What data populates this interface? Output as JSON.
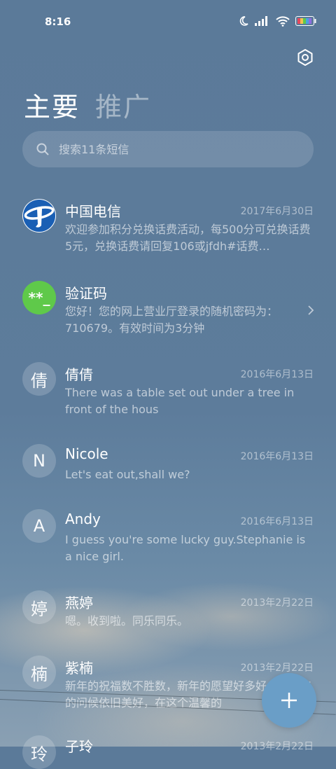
{
  "status_bar": {
    "time": "8:16"
  },
  "tabs": [
    {
      "label": "主要"
    },
    {
      "label": "推广"
    }
  ],
  "search": {
    "placeholder": "搜索11条短信"
  },
  "messages": [
    {
      "avatar": "",
      "sender": "中国电信",
      "date": "2017年6月30日",
      "preview": "欢迎参加积分兑换话费活动，每500分可兑换话费5元，兑换话费请回复106或jfdh#话费…"
    },
    {
      "avatar": "**_",
      "sender": "验证码",
      "date": "",
      "preview": "您好！您的网上营业厅登录的随机密码为：710679。有效时间为3分钟"
    },
    {
      "avatar": "倩",
      "sender": "倩倩",
      "date": "2016年6月13日",
      "preview": "There was a table set out under a tree in front of the hous"
    },
    {
      "avatar": "N",
      "sender": "Nicole",
      "date": "2016年6月13日",
      "preview": "Let's eat out,shall we?"
    },
    {
      "avatar": "A",
      "sender": "Andy",
      "date": "2016年6月13日",
      "preview": "I guess you're some lucky guy.Stephanie is a nice girl."
    },
    {
      "avatar": "婷",
      "sender": "燕婷",
      "date": "2013年2月22日",
      "preview": "嗯。收到啦。同乐同乐。"
    },
    {
      "avatar": "楠",
      "sender": "紫楠",
      "date": "2013年2月22日",
      "preview": "新年的祝福数不胜数，新年的愿望好多好多，新年的问候依旧美好，在这个温馨的"
    },
    {
      "avatar": "玲",
      "sender": "子玲",
      "date": "2013年2月22日",
      "preview": ""
    }
  ],
  "colors": {
    "accent": "#6a9ec7",
    "verify_avatar": "#5fc94a",
    "telecom_blue": "#1a5fb4"
  }
}
